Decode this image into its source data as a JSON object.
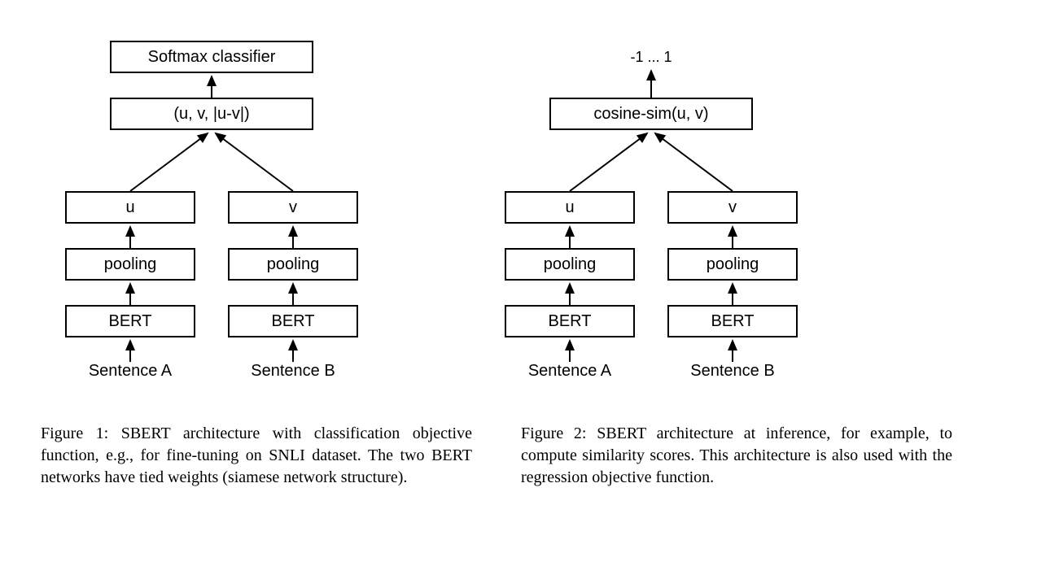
{
  "figure1": {
    "top_box": "Softmax classifier",
    "merge_box": "(u, v, |u-v|)",
    "left": {
      "vec": "u",
      "pooling": "pooling",
      "bert": "BERT",
      "input": "Sentence A"
    },
    "right": {
      "vec": "v",
      "pooling": "pooling",
      "bert": "BERT",
      "input": "Sentence B"
    },
    "caption": "Figure 1: SBERT architecture with classification objective function, e.g., for fine-tuning on SNLI dataset. The two BERT networks have tied weights (siamese network structure)."
  },
  "figure2": {
    "top_label": "-1 ... 1",
    "merge_box": "cosine-sim(u, v)",
    "left": {
      "vec": "u",
      "pooling": "pooling",
      "bert": "BERT",
      "input": "Sentence A"
    },
    "right": {
      "vec": "v",
      "pooling": "pooling",
      "bert": "BERT",
      "input": "Sentence B"
    },
    "caption": "Figure 2: SBERT architecture at inference, for example, to compute similarity scores. This architecture is also used with the regression objective function."
  }
}
